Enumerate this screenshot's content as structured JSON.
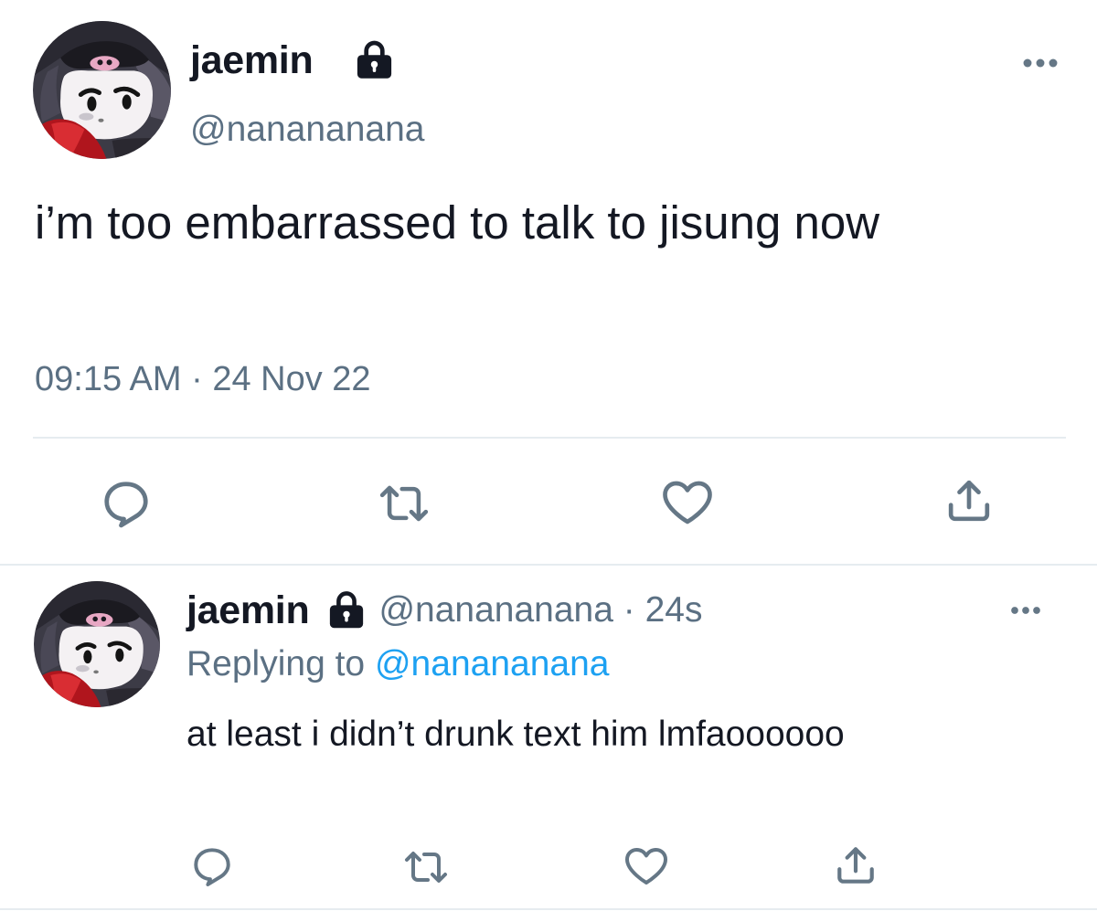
{
  "main_tweet": {
    "display_name": "jaemin",
    "handle": "@nanananana",
    "text": "i’m too embarrassed to talk to jisung now",
    "timestamp": "09:15 AM · 24 Nov 22"
  },
  "reply_tweet": {
    "display_name": "jaemin",
    "handle_time": "@nanananana · 24s",
    "replying_label": "Replying to",
    "replying_handle": "@nanananana",
    "text": "at least i didn’t drunk text him lmfaoooooo"
  },
  "icons": {
    "lock": "lock-icon",
    "more": "more-icon",
    "reply": "reply-icon",
    "retweet": "retweet-icon",
    "like": "heart-icon",
    "share": "share-icon"
  },
  "colors": {
    "text": "#141823",
    "secondary": "#5b7083",
    "link": "#1da1f2",
    "divider": "#e6ecf0",
    "icon": "#657786"
  }
}
